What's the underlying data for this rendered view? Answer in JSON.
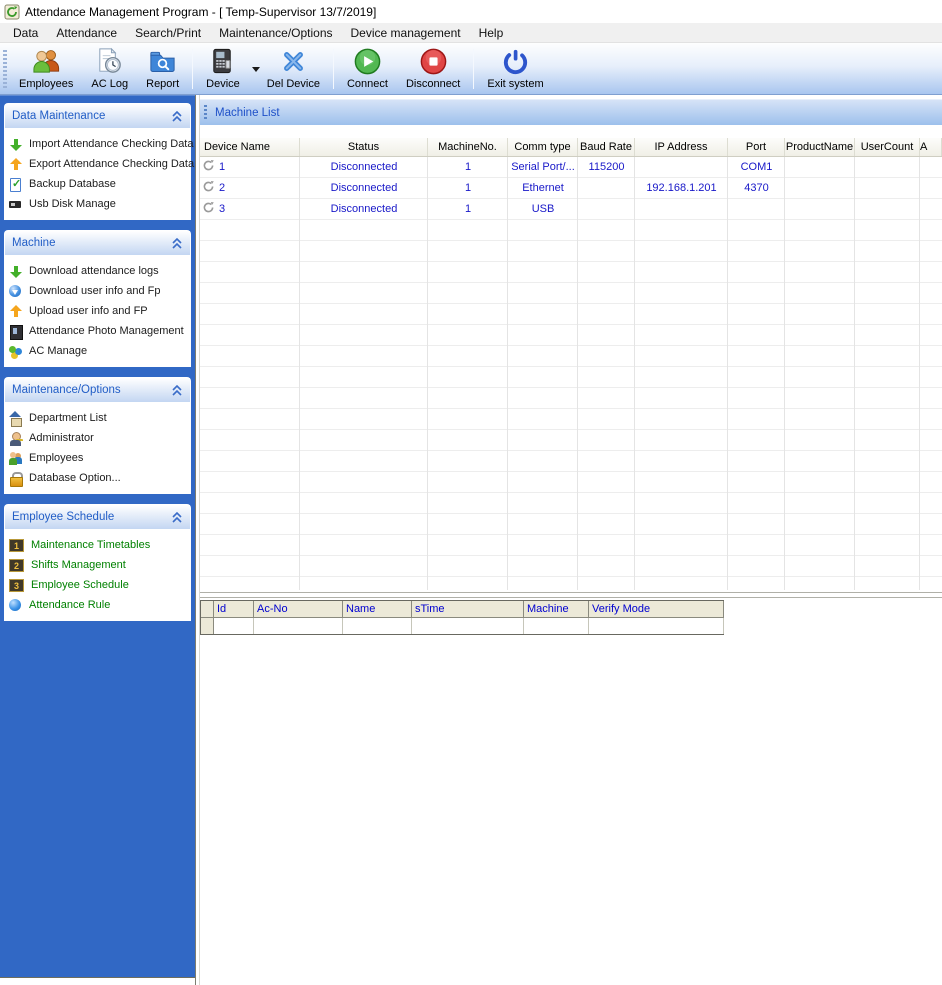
{
  "window": {
    "title": "Attendance Management Program - [ Temp-Supervisor 13/7/2019]"
  },
  "menu": {
    "items": [
      {
        "label": "Data"
      },
      {
        "label": "Attendance"
      },
      {
        "label": "Search/Print"
      },
      {
        "label": "Maintenance/Options"
      },
      {
        "label": "Device management"
      },
      {
        "label": "Help"
      }
    ]
  },
  "toolbar": {
    "buttons": [
      {
        "label": "Employees",
        "icon": "employees-icon"
      },
      {
        "label": "AC Log",
        "icon": "ac-log-icon"
      },
      {
        "label": "Report",
        "icon": "report-icon"
      },
      {
        "label": "Device",
        "icon": "device-icon",
        "has_dropdown": true
      },
      {
        "label": "Del Device",
        "icon": "delete-device-icon"
      },
      {
        "label": "Connect",
        "icon": "connect-icon"
      },
      {
        "label": "Disconnect",
        "icon": "disconnect-icon"
      },
      {
        "label": "Exit system",
        "icon": "exit-system-icon"
      }
    ]
  },
  "sidebar": {
    "sections": [
      {
        "title": "Data Maintenance",
        "items": [
          {
            "label": "Import Attendance Checking Data",
            "icon": "import-arrow"
          },
          {
            "label": "Export Attendance Checking Data",
            "icon": "export-arrow"
          },
          {
            "label": "Backup Database",
            "icon": "backup-database"
          },
          {
            "label": "Usb Disk Manage",
            "icon": "usb-disk"
          }
        ]
      },
      {
        "title": "Machine",
        "items": [
          {
            "label": "Download attendance logs",
            "icon": "download-logs"
          },
          {
            "label": "Download user info and Fp",
            "icon": "download-user"
          },
          {
            "label": "Upload user info and FP",
            "icon": "upload-user"
          },
          {
            "label": "Attendance Photo Management",
            "icon": "attendance-photo"
          },
          {
            "label": "AC Manage",
            "icon": "ac-manage"
          }
        ]
      },
      {
        "title": "Maintenance/Options",
        "items": [
          {
            "label": "Department List",
            "icon": "department"
          },
          {
            "label": "Administrator",
            "icon": "administrator"
          },
          {
            "label": "Employees",
            "icon": "employees-small"
          },
          {
            "label": "Database Option...",
            "icon": "database-lock"
          }
        ]
      },
      {
        "title": "Employee Schedule",
        "accent": "green",
        "items": [
          {
            "label": "Maintenance Timetables",
            "icon": "timetable-1"
          },
          {
            "label": "Shifts Management",
            "icon": "timetable-2"
          },
          {
            "label": "Employee Schedule",
            "icon": "timetable-3"
          },
          {
            "label": "Attendance Rule",
            "icon": "blue-ball"
          }
        ]
      }
    ]
  },
  "main": {
    "machine_list": {
      "title": "Machine List",
      "columns": [
        "Device Name",
        "Status",
        "MachineNo.",
        "Comm type",
        "Baud Rate",
        "IP Address",
        "Port",
        "ProductName",
        "UserCount",
        "A"
      ],
      "rows": [
        [
          "1",
          "Disconnected",
          "1",
          "Serial Port/...",
          "115200",
          "",
          "COM1",
          "",
          "",
          ""
        ],
        [
          "2",
          "Disconnected",
          "1",
          "Ethernet",
          "",
          "192.168.1.201",
          "4370",
          "",
          "",
          ""
        ],
        [
          "3",
          "Disconnected",
          "1",
          "USB",
          "",
          "",
          "",
          "",
          "",
          ""
        ]
      ]
    },
    "log_grid": {
      "columns": [
        "Id",
        "Ac-No",
        "Name",
        "sTime",
        "Machine",
        "Verify Mode"
      ]
    }
  },
  "colors": {
    "sidebar_blue": "#3168c5",
    "section_title_blue": "#215dc6",
    "data_text_blue": "#1818c8",
    "green_item_text": "#008000",
    "grid_header_beige": "#ece9d8"
  }
}
